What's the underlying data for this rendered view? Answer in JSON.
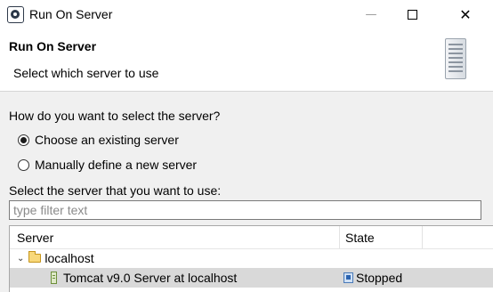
{
  "window": {
    "title": "Run On Server",
    "minimize_glyph": "—",
    "close_glyph": "✕"
  },
  "header": {
    "title": "Run On Server",
    "subtitle": "Select which server to use",
    "graphic": "server-icon"
  },
  "selection": {
    "question": "How do you want to select the server?",
    "options": [
      {
        "label": "Choose an existing server",
        "selected": true
      },
      {
        "label": "Manually define a new server",
        "selected": false
      }
    ]
  },
  "server_list": {
    "label": "Select the server that you want to use:",
    "filter_placeholder": "type filter text",
    "filter_value": "",
    "columns": [
      "Server",
      "State"
    ],
    "tree": {
      "expand_glyph": "⌄",
      "group": "localhost",
      "items": [
        {
          "name": "Tomcat v9.0 Server at localhost",
          "state": "Stopped",
          "selected": true
        }
      ]
    }
  },
  "colors": {
    "body_background": "#f0f0f0",
    "selected_row": "#d9d9d9"
  }
}
